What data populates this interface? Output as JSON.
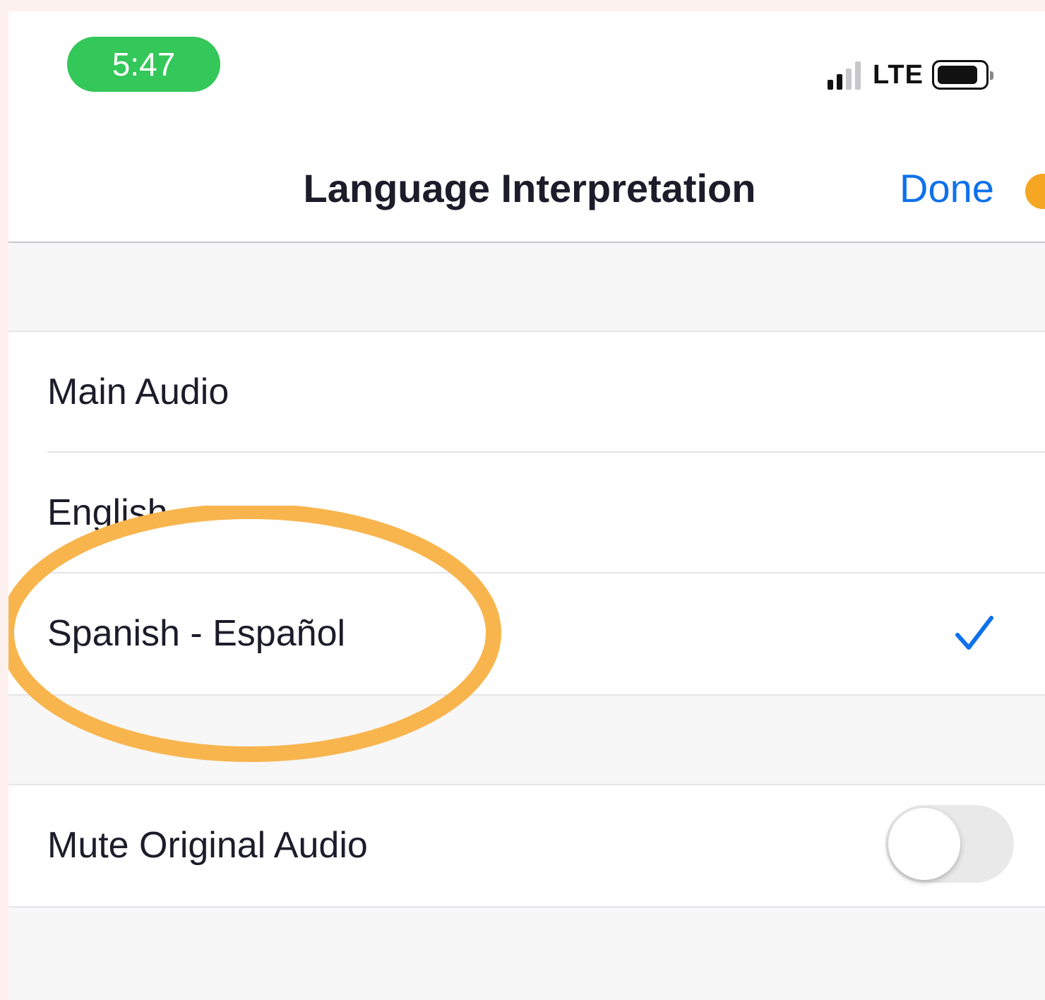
{
  "status_bar": {
    "time": "5:47",
    "network": "LTE"
  },
  "nav": {
    "title": "Language Interpretation",
    "done_label": "Done"
  },
  "language_options": [
    {
      "label": "Main Audio",
      "selected": false
    },
    {
      "label": "English",
      "selected": false
    },
    {
      "label": "Spanish - Español",
      "selected": true
    }
  ],
  "mute_setting": {
    "label": "Mute Original Audio",
    "enabled": false
  },
  "colors": {
    "accent": "#0e71eb",
    "annotation": "#f8b54e",
    "time_pill": "#34c759"
  },
  "icons": [
    "signal-icon",
    "battery-icon",
    "checkmark-icon",
    "toggle-switch"
  ]
}
